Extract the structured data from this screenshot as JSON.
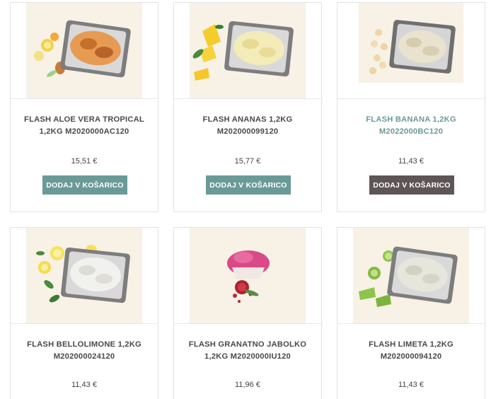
{
  "products": [
    {
      "title_line1": "FLASH ALOE VERA TROPICAL",
      "title_line2": "1,2KG M2020000AC120",
      "price": "15,51 €",
      "button": "DODAJ V KOŠARICO",
      "state": "default",
      "image_icon": "gelato-tray-aloe-tropical"
    },
    {
      "title_line1": "FLASH ANANAS 1,2KG",
      "title_line2": "M202000099120",
      "price": "15,77 €",
      "button": "DODAJ V KOŠARICO",
      "state": "default",
      "image_icon": "gelato-tray-pineapple"
    },
    {
      "title_line1": "FLASH BANANA 1,2KG",
      "title_line2": "M2022000BC120",
      "price": "11,43 €",
      "button": "DODAJ V KOŠARICO",
      "state": "hover",
      "image_icon": "gelato-tray-banana"
    },
    {
      "title_line1": "FLASH BELLOLIMONE 1,2KG",
      "title_line2": "M202000024120",
      "price": "11,43 €",
      "image_icon": "gelato-tray-lemon"
    },
    {
      "title_line1": "FLASH GRANATNO JABOLKO",
      "title_line2": "1,2KG M2020000IU120",
      "price": "11,96 €",
      "image_icon": "gelato-cone-pomegranate"
    },
    {
      "title_line1": "FLASH LIMETA 1,2KG",
      "title_line2": "M202000094120",
      "price": "11,43 €",
      "image_icon": "gelato-tray-lime"
    }
  ],
  "colors": {
    "button_default": "#6a9a98",
    "button_hover": "#5e5557",
    "title_hover": "#6a9a98",
    "image_bg": "#f7f1e6"
  }
}
